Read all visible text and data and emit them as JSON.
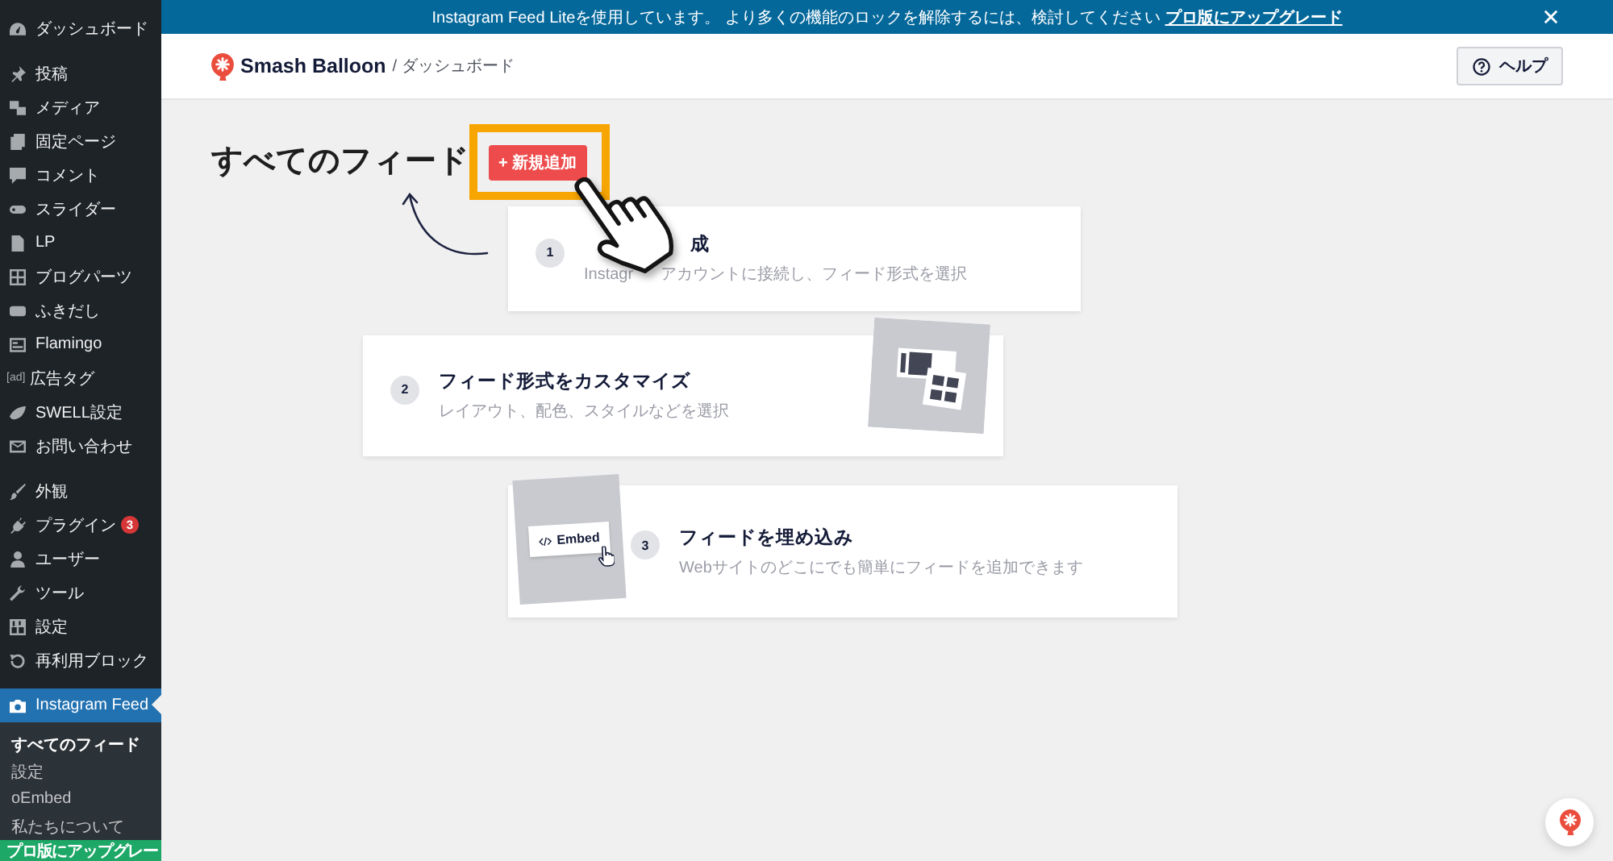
{
  "sidebar": {
    "sections": [
      {
        "items": [
          {
            "label": "ダッシュボード",
            "selected": false
          }
        ]
      },
      {
        "items": [
          {
            "label": "投稿",
            "selected": false
          },
          {
            "label": "メディア",
            "selected": false
          },
          {
            "label": "固定ページ",
            "selected": false
          },
          {
            "label": "コメント",
            "selected": false
          },
          {
            "label": "スライダー",
            "selected": false
          },
          {
            "label": "LP",
            "selected": false
          },
          {
            "label": "ブログパーツ",
            "selected": false
          },
          {
            "label": "ふきだし",
            "selected": false
          },
          {
            "label": "Flamingo",
            "selected": false
          },
          {
            "label": "広告タグ",
            "icon_text": "[ad]",
            "selected": false
          },
          {
            "label": "SWELL設定",
            "selected": false
          },
          {
            "label": "お問い合わせ",
            "selected": false
          }
        ]
      },
      {
        "items": [
          {
            "label": "外観",
            "selected": false
          },
          {
            "label": "プラグイン",
            "badge": "3",
            "selected": false
          },
          {
            "label": "ユーザー",
            "selected": false
          },
          {
            "label": "ツール",
            "selected": false
          },
          {
            "label": "設定",
            "selected": false
          },
          {
            "label": "再利用ブロック",
            "selected": false
          }
        ]
      },
      {
        "items": [
          {
            "label": "Instagram Feed",
            "selected": true,
            "children": [
              {
                "label": "すべてのフィード",
                "selected": true
              },
              {
                "label": "設定",
                "selected": false
              },
              {
                "label": "oEmbed",
                "selected": false
              },
              {
                "label": "私たちについて",
                "selected": false
              }
            ]
          }
        ]
      }
    ],
    "upgrade_item": "プロ版にアップグレー"
  },
  "notice": {
    "text": "Instagram Feed Liteを使用しています。 より多くの機能のロックを解除するには、検討してください",
    "link": "プロ版にアップグレード"
  },
  "header": {
    "brand": "Smash Balloon",
    "breadcrumb": "/ ダッシュボード",
    "help_button": "ヘルプ"
  },
  "page": {
    "title": "すべてのフィード",
    "add_button": {
      "label": "+ 新規追加",
      "highlighted": true
    },
    "pointer_hand": true
  },
  "cards": [
    {
      "kind": "plain",
      "step": "1",
      "title": "成",
      "subtitle": [
        "Instagr",
        "アカウントに接続し、フィード形式を選択"
      ],
      "covered": true
    },
    {
      "kind": "layouts",
      "step": "2",
      "title": "フィード形式をカスタマイズ",
      "subtitle": [
        "レイアウト、配色、スタイルなどを選択"
      ],
      "covered": false
    },
    {
      "kind": "embed",
      "step": "3",
      "title": "フィードを埋め込み",
      "subtitle": [
        "Webサイトのどこにでも簡単にフィードを追加できます"
      ],
      "embed_label": "Embed",
      "covered": false
    }
  ]
}
